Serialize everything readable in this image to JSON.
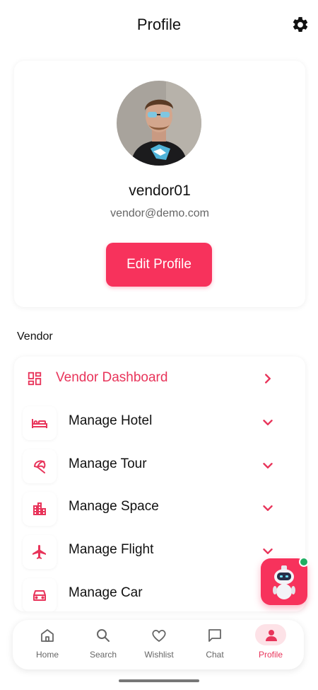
{
  "header": {
    "title": "Profile"
  },
  "profile": {
    "username": "vendor01",
    "email": "vendor@demo.com",
    "edit_label": "Edit Profile"
  },
  "vendor_section": {
    "title": "Vendor",
    "dashboard_label": "Vendor Dashboard",
    "items": [
      {
        "label": "Manage Hotel",
        "icon": "bed-icon"
      },
      {
        "label": "Manage Tour",
        "icon": "umbrella-icon"
      },
      {
        "label": "Manage Space",
        "icon": "building-icon"
      },
      {
        "label": "Manage Flight",
        "icon": "airplane-icon"
      },
      {
        "label": "Manage Car",
        "icon": "car-icon"
      }
    ]
  },
  "bottom_nav": {
    "items": [
      {
        "label": "Home",
        "icon": "home-icon"
      },
      {
        "label": "Search",
        "icon": "search-icon"
      },
      {
        "label": "Wishlist",
        "icon": "heart-icon"
      },
      {
        "label": "Chat",
        "icon": "chat-icon"
      },
      {
        "label": "Profile",
        "icon": "person-icon"
      }
    ],
    "active": "Profile"
  },
  "colors": {
    "accent": "#f7325c",
    "accent_text": "#e8345a",
    "online": "#1fae62"
  }
}
